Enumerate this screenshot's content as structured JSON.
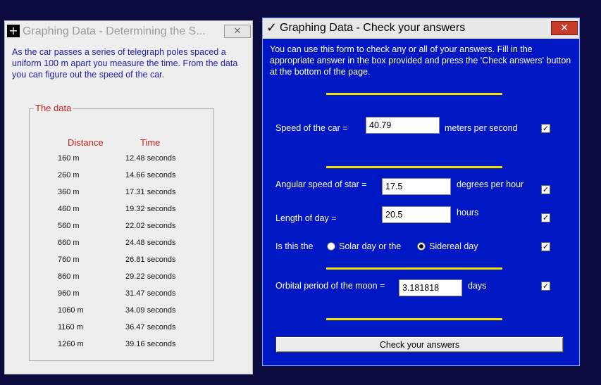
{
  "left_window": {
    "title": "Graphing Data - Determining the S...",
    "close_glyph": "✕",
    "app_icon_glyph": "+",
    "intro": "As the car passes a series of telegraph poles spaced a uniform 100 m apart you measure the time. From the data you can figure out the speed of the car.",
    "group_label": "The data",
    "col_distance": "Distance",
    "col_time": "Time",
    "rows": [
      {
        "distance": "160 m",
        "time": "12.48 seconds"
      },
      {
        "distance": "260 m",
        "time": "14.66 seconds"
      },
      {
        "distance": "360 m",
        "time": "17.31 seconds"
      },
      {
        "distance": "460 m",
        "time": "19.32 seconds"
      },
      {
        "distance": "560 m",
        "time": "22.02 seconds"
      },
      {
        "distance": "660 m",
        "time": "24.48 seconds"
      },
      {
        "distance": "760 m",
        "time": "26.81 seconds"
      },
      {
        "distance": "860 m",
        "time": "29.22 seconds"
      },
      {
        "distance": "960 m",
        "time": "31.47 seconds"
      },
      {
        "distance": "1060 m",
        "time": "34.09 seconds"
      },
      {
        "distance": "1160 m",
        "time": "36.47 seconds"
      },
      {
        "distance": "1260 m",
        "time": "39.16 seconds"
      }
    ]
  },
  "right_window": {
    "title": "Graphing Data - Check your answers",
    "title_check_glyph": "✓",
    "close_glyph": "✕",
    "intro": "You can use this form to check any or all of your answers. Fill in the appropriate answer in the box provided and press the 'Check answers' button at the bottom of the page.",
    "speed": {
      "label": "Speed of the car =",
      "value": "40.79",
      "unit": "meters per second",
      "checked": true
    },
    "angular": {
      "label": "Angular speed of star =",
      "value": "17.5",
      "unit": "degrees per hour",
      "checked": true
    },
    "length": {
      "label": "Length of day =",
      "value": "20.5",
      "unit": "hours",
      "checked": true
    },
    "daytype": {
      "label": "Is this the",
      "option1": "Solar day or the",
      "option2": "Sidereal day",
      "selected": "option2",
      "checked": true
    },
    "orbital": {
      "label": "Orbital period of the moon =",
      "value": "3.181818",
      "unit": "days",
      "checked": true
    },
    "check_mark_glyph": "✓",
    "button_label": "Check your answers",
    "colors": {
      "background": "#0018c4",
      "divider": "#f2e000",
      "text": "#ffffff"
    }
  }
}
